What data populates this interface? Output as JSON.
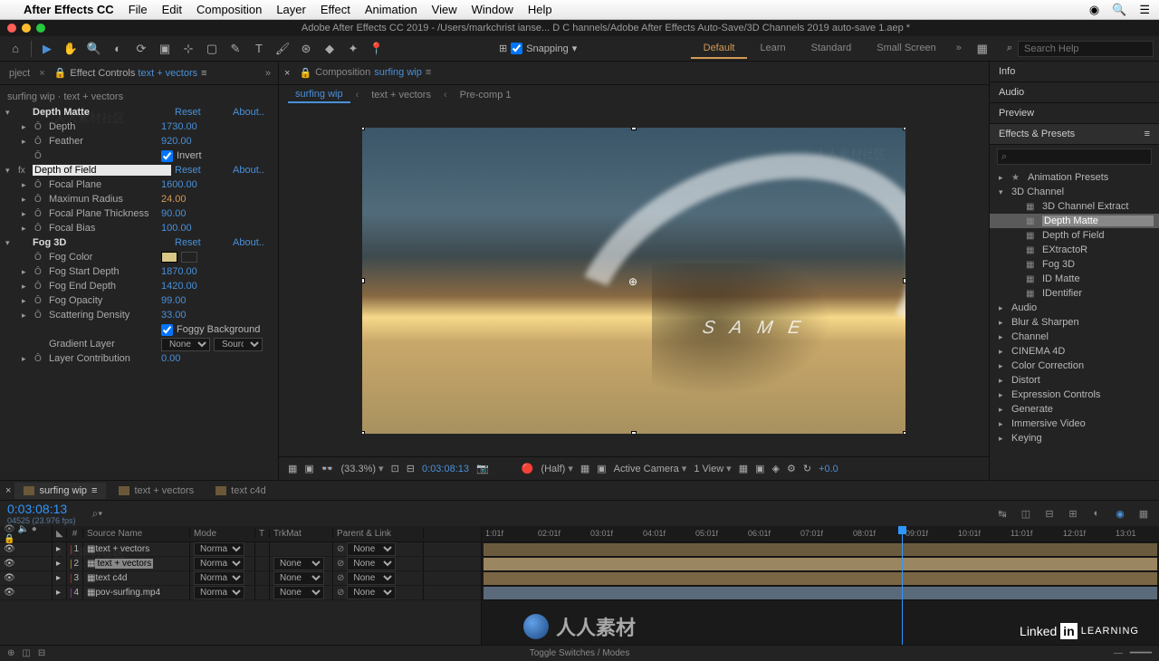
{
  "menubar": {
    "app": "After Effects CC",
    "items": [
      "File",
      "Edit",
      "Composition",
      "Layer",
      "Effect",
      "Animation",
      "View",
      "Window",
      "Help"
    ]
  },
  "window_title": "Adobe After Effects CC 2019 - /Users/markchrist ianse... D C hannels/Adobe After Effects Auto-Save/3D Channels 2019 auto-save 1.aep *",
  "snapping": {
    "label": "Snapping"
  },
  "workspaces": {
    "active": "Default",
    "tabs": [
      "Default",
      "Learn",
      "Standard",
      "Small Screen"
    ]
  },
  "search_help_placeholder": "Search Help",
  "left_panel": {
    "project_tab": "pject",
    "effect_controls_label": "Effect Controls",
    "effect_controls_layer": "text + vectors",
    "path": "surfing wip · text + vectors",
    "groups": [
      {
        "name": "Depth Matte",
        "reset": "Reset",
        "about": "About..",
        "props": [
          {
            "name": "Depth",
            "value": "1730.00"
          },
          {
            "name": "Feather",
            "value": "920.00"
          },
          {
            "name": "",
            "checkbox": true,
            "cblabel": "Invert"
          }
        ]
      },
      {
        "name": "Depth of Field",
        "reset": "Reset",
        "about": "About..",
        "selected": true,
        "props": [
          {
            "name": "Focal Plane",
            "value": "1600.00"
          },
          {
            "name": "Maximun Radius",
            "value": "24.00",
            "hot": true
          },
          {
            "name": "Focal Plane Thickness",
            "value": "90.00"
          },
          {
            "name": "Focal Bias",
            "value": "100.00"
          }
        ]
      },
      {
        "name": "Fog 3D",
        "reset": "Reset",
        "about": "About..",
        "props": [
          {
            "name": "Fog Color",
            "swatch": true
          },
          {
            "name": "Fog Start Depth",
            "value": "1870.00"
          },
          {
            "name": "Fog End Depth",
            "value": "1420.00"
          },
          {
            "name": "Fog Opacity",
            "value": "99.00"
          },
          {
            "name": "Scattering Density",
            "value": "33.00"
          },
          {
            "name": "",
            "checkbox": true,
            "cblabel": "Foggy Background"
          },
          {
            "name": "Gradient Layer",
            "dropdown": [
              "None",
              "Source"
            ]
          },
          {
            "name": "Layer Contribution",
            "value": "0.00"
          }
        ]
      }
    ]
  },
  "center": {
    "comp_label": "Composition",
    "comp_name": "surfing wip",
    "breadcrumb": [
      "surfing wip",
      "text + vectors",
      "Pre-comp 1"
    ],
    "overlay_text": "S A M E",
    "footer": {
      "zoom": "(33.3%)",
      "time": "0:03:08:13",
      "res": "(Half)",
      "camera": "Active Camera",
      "view": "1 View",
      "exposure": "+0.0"
    }
  },
  "right": {
    "sections": [
      "Info",
      "Audio",
      "Preview"
    ],
    "ep_title": "Effects & Presets",
    "search_placeholder": "⌕",
    "tree": [
      {
        "l": 1,
        "tw": "▸",
        "star": true,
        "label": "Animation Presets"
      },
      {
        "l": 1,
        "tw": "▾",
        "label": "3D Channel"
      },
      {
        "l": 2,
        "fx": true,
        "label": "3D Channel Extract"
      },
      {
        "l": 2,
        "fx": true,
        "label": "Depth Matte",
        "selected": true
      },
      {
        "l": 2,
        "fx": true,
        "label": "Depth of Field"
      },
      {
        "l": 2,
        "fx": true,
        "label": "EXtractoR"
      },
      {
        "l": 2,
        "fx": true,
        "label": "Fog 3D"
      },
      {
        "l": 2,
        "fx": true,
        "label": "ID Matte"
      },
      {
        "l": 2,
        "fx": true,
        "label": "IDentifier"
      },
      {
        "l": 1,
        "tw": "▸",
        "label": "Audio"
      },
      {
        "l": 1,
        "tw": "▸",
        "label": "Blur & Sharpen"
      },
      {
        "l": 1,
        "tw": "▸",
        "label": "Channel"
      },
      {
        "l": 1,
        "tw": "▸",
        "label": "CINEMA 4D"
      },
      {
        "l": 1,
        "tw": "▸",
        "label": "Color Correction"
      },
      {
        "l": 1,
        "tw": "▸",
        "label": "Distort"
      },
      {
        "l": 1,
        "tw": "▸",
        "label": "Expression Controls"
      },
      {
        "l": 1,
        "tw": "▸",
        "label": "Generate"
      },
      {
        "l": 1,
        "tw": "▸",
        "label": "Immersive Video"
      },
      {
        "l": 1,
        "tw": "▸",
        "label": "Keying"
      }
    ]
  },
  "timeline": {
    "tabs": [
      "surfing wip",
      "text + vectors",
      "text c4d"
    ],
    "timecode": "0:03:08:13",
    "frames": "04525 (23.976 fps)",
    "cols": {
      "num": "#",
      "name": "Source Name",
      "mode": "Mode",
      "t": "T",
      "trk": "TrkMat",
      "parent": "Parent & Link"
    },
    "layers": [
      {
        "num": 1,
        "name": "text + vectors",
        "mode": "Normal",
        "trk": "",
        "parent": "None",
        "lc": "lc1"
      },
      {
        "num": 2,
        "name": "text + vectors",
        "mode": "Normal",
        "trk": "None",
        "parent": "None",
        "lc": "lc2",
        "selected": true
      },
      {
        "num": 3,
        "name": "text c4d",
        "mode": "Normal",
        "trk": "None",
        "parent": "None",
        "lc": "lc1"
      },
      {
        "num": 4,
        "name": "pov-surfing.mp4",
        "mode": "Normal",
        "trk": "None",
        "parent": "None",
        "lc": "lc3"
      }
    ],
    "ruler": [
      "1:01f",
      "02:01f",
      "03:01f",
      "04:01f",
      "05:01f",
      "06:01f",
      "07:01f",
      "08:01f",
      "09:01f",
      "10:01f",
      "11:01f",
      "12:01f",
      "13:01"
    ],
    "toggle": "Toggle Switches / Modes"
  },
  "branding": {
    "linkedin": "Linked",
    "learning": "LEARNING",
    "center": "人人素材"
  }
}
